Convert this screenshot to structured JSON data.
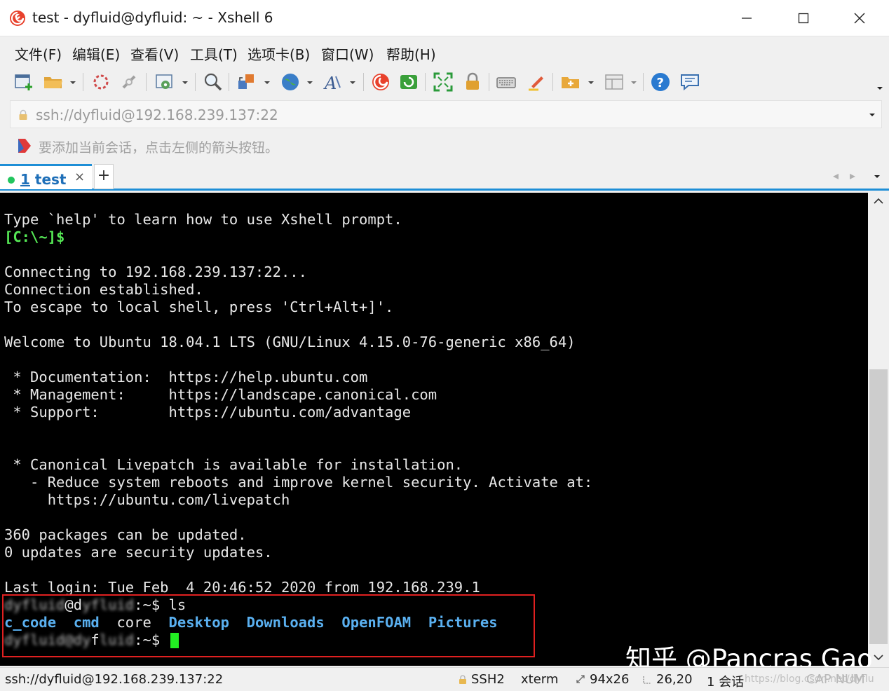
{
  "window": {
    "title": "test - dyfluid@dyfluid: ~ - Xshell 6"
  },
  "menu": [
    "文件(F)",
    "编辑(E)",
    "查看(V)",
    "工具(T)",
    "选项卡(B)",
    "窗口(W)",
    "帮助(H)"
  ],
  "address": {
    "value": "ssh://dyfluid@192.168.239.137:22"
  },
  "hint": {
    "text": "要添加当前会话，点击左侧的箭头按钮。"
  },
  "tabs": {
    "active_number": "1",
    "active_label": " test",
    "close": "×",
    "add": "+"
  },
  "terminal": {
    "lines": [
      "Type `help' to learn how to use Xshell prompt.",
      "[C:\\~]$",
      "Connecting to 192.168.239.137:22...",
      "Connection established.",
      "To escape to local shell, press 'Ctrl+Alt+]'.",
      "Welcome to Ubuntu 18.04.1 LTS (GNU/Linux 4.15.0-76-generic x86_64)",
      " * Documentation:  https://help.ubuntu.com",
      " * Management:     https://landscape.canonical.com",
      " * Support:        https://ubuntu.com/advantage",
      " * Canonical Livepatch is available for installation.",
      "   - Reduce system reboots and improve kernel security. Activate at:",
      "     https://ubuntu.com/livepatch",
      "360 packages can be updated.",
      "0 updates are security updates.",
      "Last login: Tue Feb  4 20:46:52 2020 from 192.168.239.1"
    ],
    "prompt1": {
      "user_blurred": "dyfluid",
      "at": "@d",
      "host_blurred": "yfluid",
      "suffix": ":~$ ",
      "command": "ls"
    },
    "ls_output": [
      {
        "name": "c_code",
        "type": "dir"
      },
      {
        "name": "cmd",
        "type": "dir"
      },
      {
        "name": "core",
        "type": "file"
      },
      {
        "name": "Desktop",
        "type": "dir"
      },
      {
        "name": "Downloads",
        "type": "dir"
      },
      {
        "name": "OpenFOAM",
        "type": "dir"
      },
      {
        "name": "Pictures",
        "type": "dir"
      }
    ],
    "prompt2": {
      "prefix_blurred": "dyfluid@dy",
      "mid": "f",
      "rest_blurred": "luid",
      "suffix": ":~$ "
    }
  },
  "watermark": "知乎 @Pancras Gao",
  "status": {
    "connection": "ssh://dyfluid@192.168.239.137:22",
    "protocol": "SSH2",
    "terminal_type": "xterm",
    "size": "94x26",
    "cursor_pos": "26,20",
    "sessions": "1 会话",
    "faint_url": "https://blog.csdn.net/dyflu",
    "caps": "CAP NUM"
  },
  "colors": {
    "accent": "#1e8ed6",
    "prompt_green": "#55e855",
    "dir_blue": "#5ab0f0",
    "highlight_red": "#e02020"
  }
}
